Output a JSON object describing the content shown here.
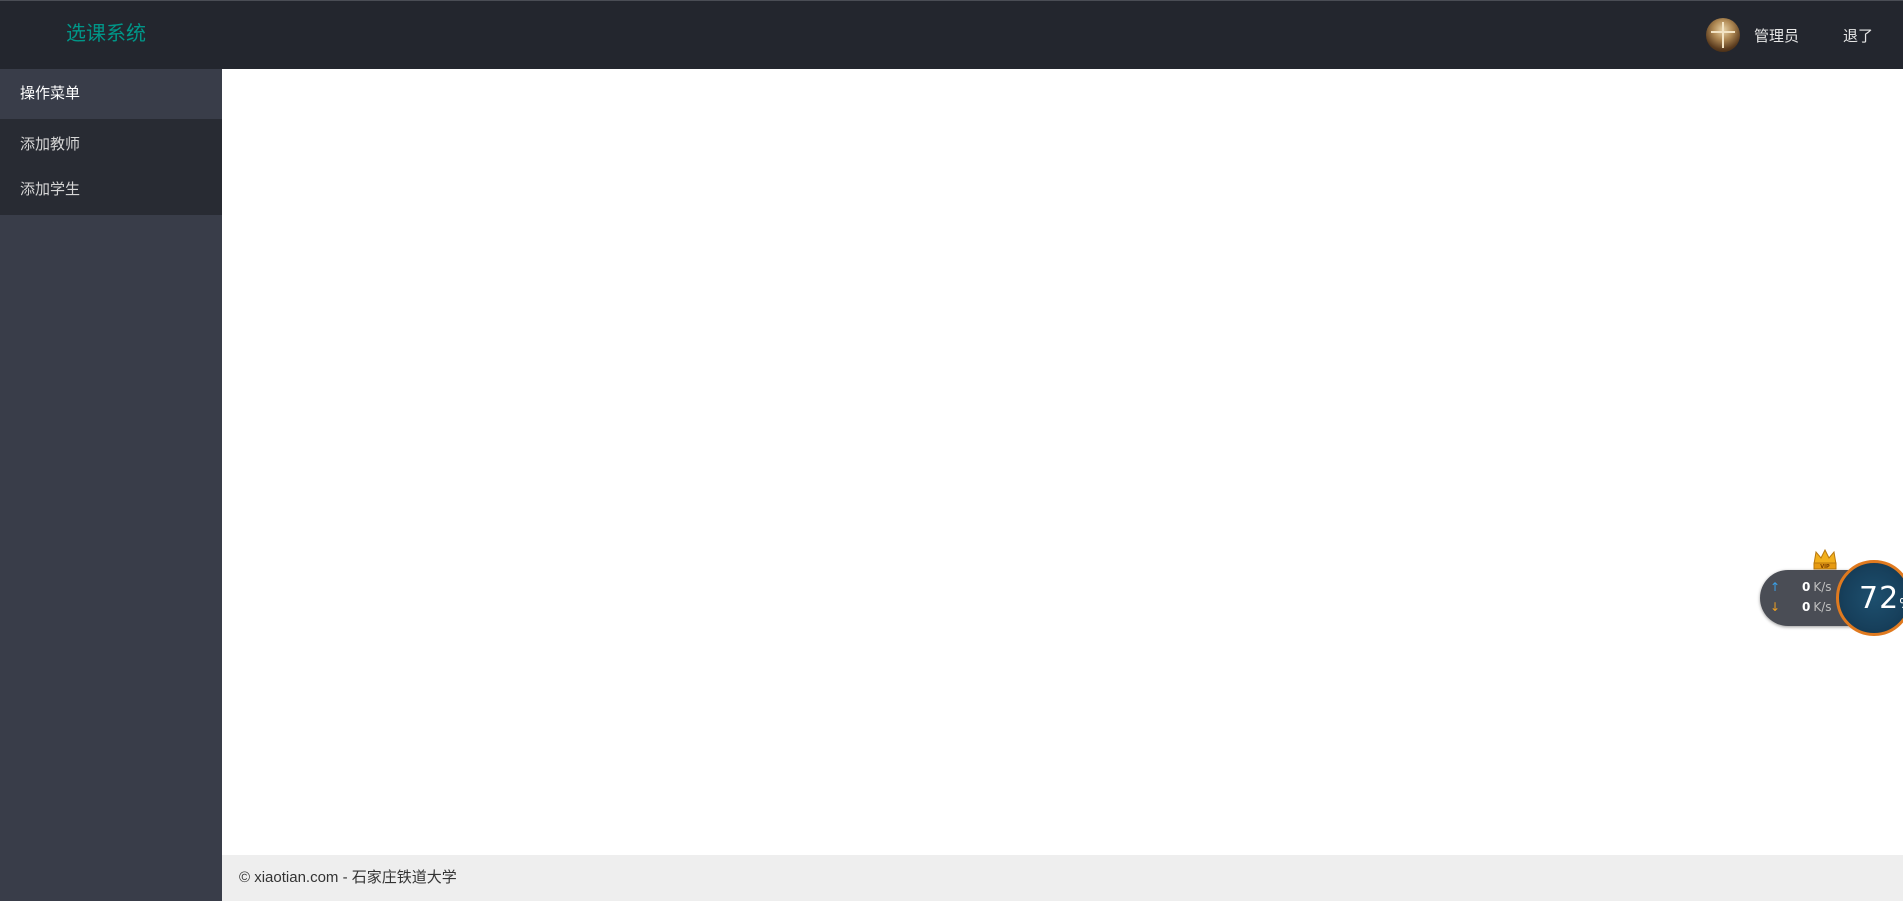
{
  "header": {
    "logo": "选课系统",
    "username": "管理员",
    "logout_label": "退了"
  },
  "sidebar": {
    "menu_title": "操作菜单",
    "items": [
      {
        "label": "添加教师"
      },
      {
        "label": "添加学生"
      }
    ]
  },
  "footer": {
    "text": "© xiaotian.com - 石家庄铁道大学"
  },
  "speed_widget": {
    "upload_value": "0",
    "upload_unit": "K/s",
    "download_value": "0",
    "download_unit": "K/s",
    "percent_value": "72",
    "percent_sign": "%",
    "crown_label": "VIP"
  },
  "colors": {
    "header_bg": "#23262e",
    "logo": "#009688",
    "sidebar_bg": "#393d49",
    "submenu_bg": "#282b33",
    "footer_bg": "#eeeeee"
  }
}
